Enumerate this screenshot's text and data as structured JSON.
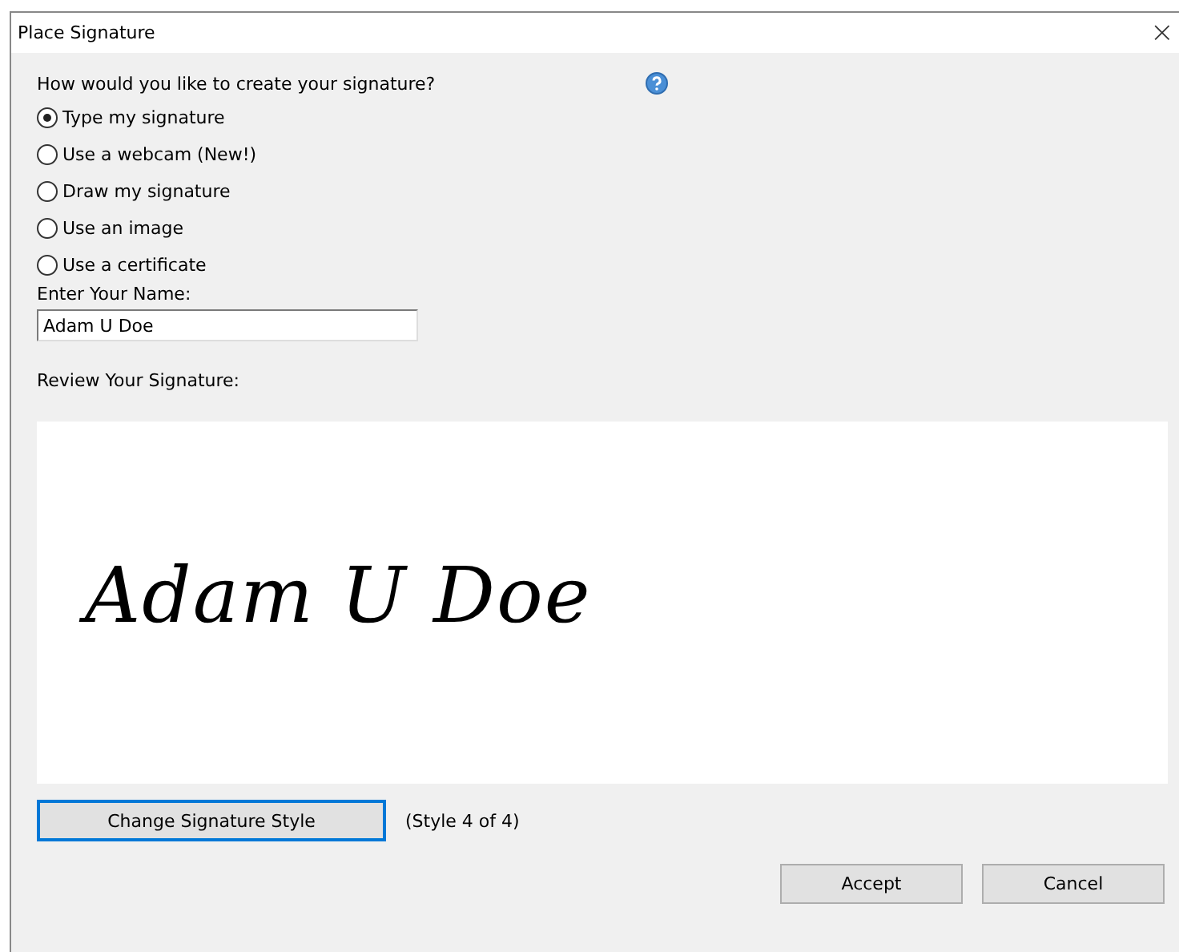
{
  "window": {
    "title": "Place Signature",
    "close": "×"
  },
  "question": "How would you like to create your signature?",
  "options": [
    {
      "label": "Type my signature",
      "selected": true
    },
    {
      "label": "Use a webcam (New!)",
      "selected": false
    },
    {
      "label": "Draw my signature",
      "selected": false
    },
    {
      "label": "Use an image",
      "selected": false
    },
    {
      "label": "Use a certificate",
      "selected": false
    }
  ],
  "name_field": {
    "label": "Enter Your Name:",
    "value": "Adam U Doe"
  },
  "review": {
    "label": "Review Your Signature:",
    "signature": "Adam U Doe"
  },
  "style_button": "Change Signature Style",
  "style_info": "(Style 4 of 4)",
  "buttons": [
    "Accept",
    "Cancel"
  ]
}
